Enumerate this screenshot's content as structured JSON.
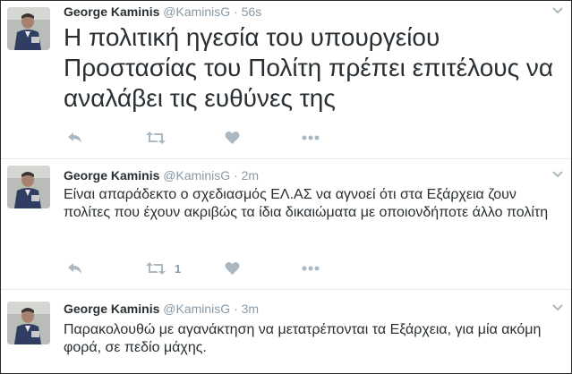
{
  "tweets": [
    {
      "name": "George Kaminis",
      "handle": "@KaminisG",
      "separator": "·",
      "time": "56s",
      "text": "Η πολιτική ηγεσία του υπουργείου Προστασίας του Πολίτη πρέπει επιτέλους να αναλάβει τις ευθύνες της",
      "retweet_count": ""
    },
    {
      "name": "George Kaminis",
      "handle": "@KaminisG",
      "separator": "·",
      "time": "2m",
      "text": "Είναι απαράδεκτο ο σχεδιασμός ΕΛ.ΑΣ να αγνοεί ότι στα Εξάρχεια ζουν πολίτες που έχουν ακριβώς τα ίδια δικαιώματα με οποιονδήποτε άλλο πολίτη",
      "retweet_count": "1"
    },
    {
      "name": "George Kaminis",
      "handle": "@KaminisG",
      "separator": "·",
      "time": "3m",
      "text": "Παρακολουθώ με αγανάκτηση να μετατρέπονται τα Εξάρχεια, για μία ακόμη φορά, σε πεδίο μάχης.",
      "retweet_count": ""
    }
  ],
  "icons": {
    "reply": "reply-icon",
    "retweet": "retweet-icon",
    "like": "heart-icon",
    "more": "more-dots-icon",
    "menu": "chevron-down-icon"
  },
  "colors": {
    "icon": "#aab8c2",
    "meta": "#8899a6",
    "text": "#292f33",
    "divider": "#e1e8ed"
  }
}
